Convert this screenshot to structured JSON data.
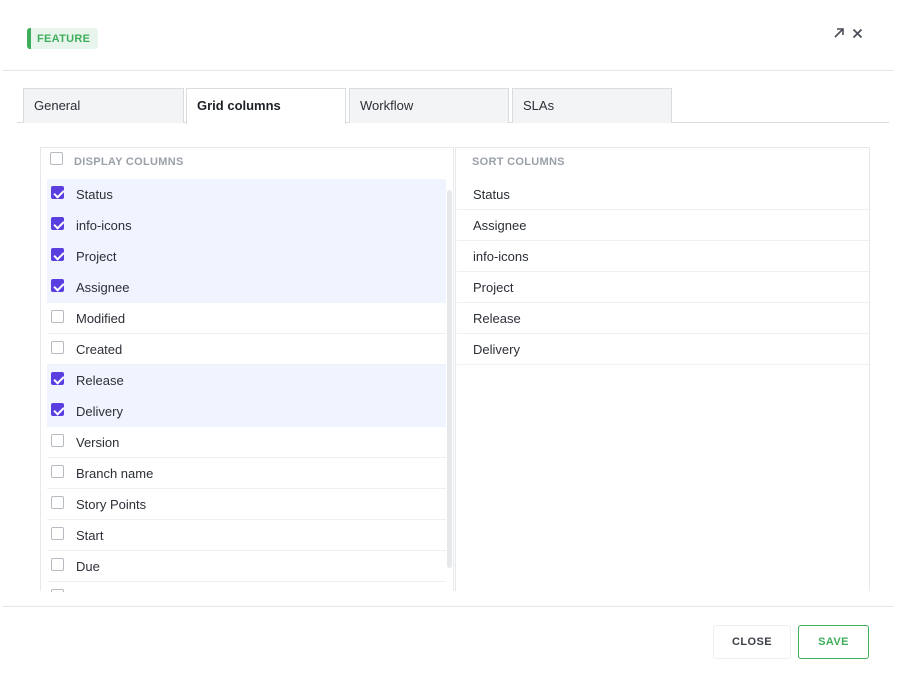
{
  "header": {
    "badge": "FEATURE",
    "accent_color": "#3fae5b",
    "icons": [
      "expand-arrow-icon",
      "close-icon"
    ]
  },
  "tabs": [
    {
      "label": "General",
      "active": false
    },
    {
      "label": "Grid columns",
      "active": true
    },
    {
      "label": "Workflow",
      "active": false
    },
    {
      "label": "SLAs",
      "active": false
    }
  ],
  "display_columns": {
    "title": "DISPLAY COLUMNS",
    "select_all_checked": false,
    "items": [
      {
        "label": "Status",
        "checked": true
      },
      {
        "label": "info-icons",
        "checked": true
      },
      {
        "label": "Project",
        "checked": true
      },
      {
        "label": "Assignee",
        "checked": true
      },
      {
        "label": "Modified",
        "checked": false
      },
      {
        "label": "Created",
        "checked": false
      },
      {
        "label": "Release",
        "checked": true
      },
      {
        "label": "Delivery",
        "checked": true
      },
      {
        "label": "Version",
        "checked": false
      },
      {
        "label": "Branch name",
        "checked": false
      },
      {
        "label": "Story Points",
        "checked": false
      },
      {
        "label": "Start",
        "checked": false
      },
      {
        "label": "Due",
        "checked": false
      },
      {
        "label": "",
        "checked": false
      }
    ]
  },
  "sort_columns": {
    "title": "SORT COLUMNS",
    "items": [
      "Status",
      "Assignee",
      "info-icons",
      "Project",
      "Release",
      "Delivery"
    ]
  },
  "footer": {
    "close_label": "CLOSE",
    "save_label": "SAVE"
  },
  "colors": {
    "checkbox_checked": "#5a3ee0",
    "row_selected_bg": "#f0f4ff"
  }
}
